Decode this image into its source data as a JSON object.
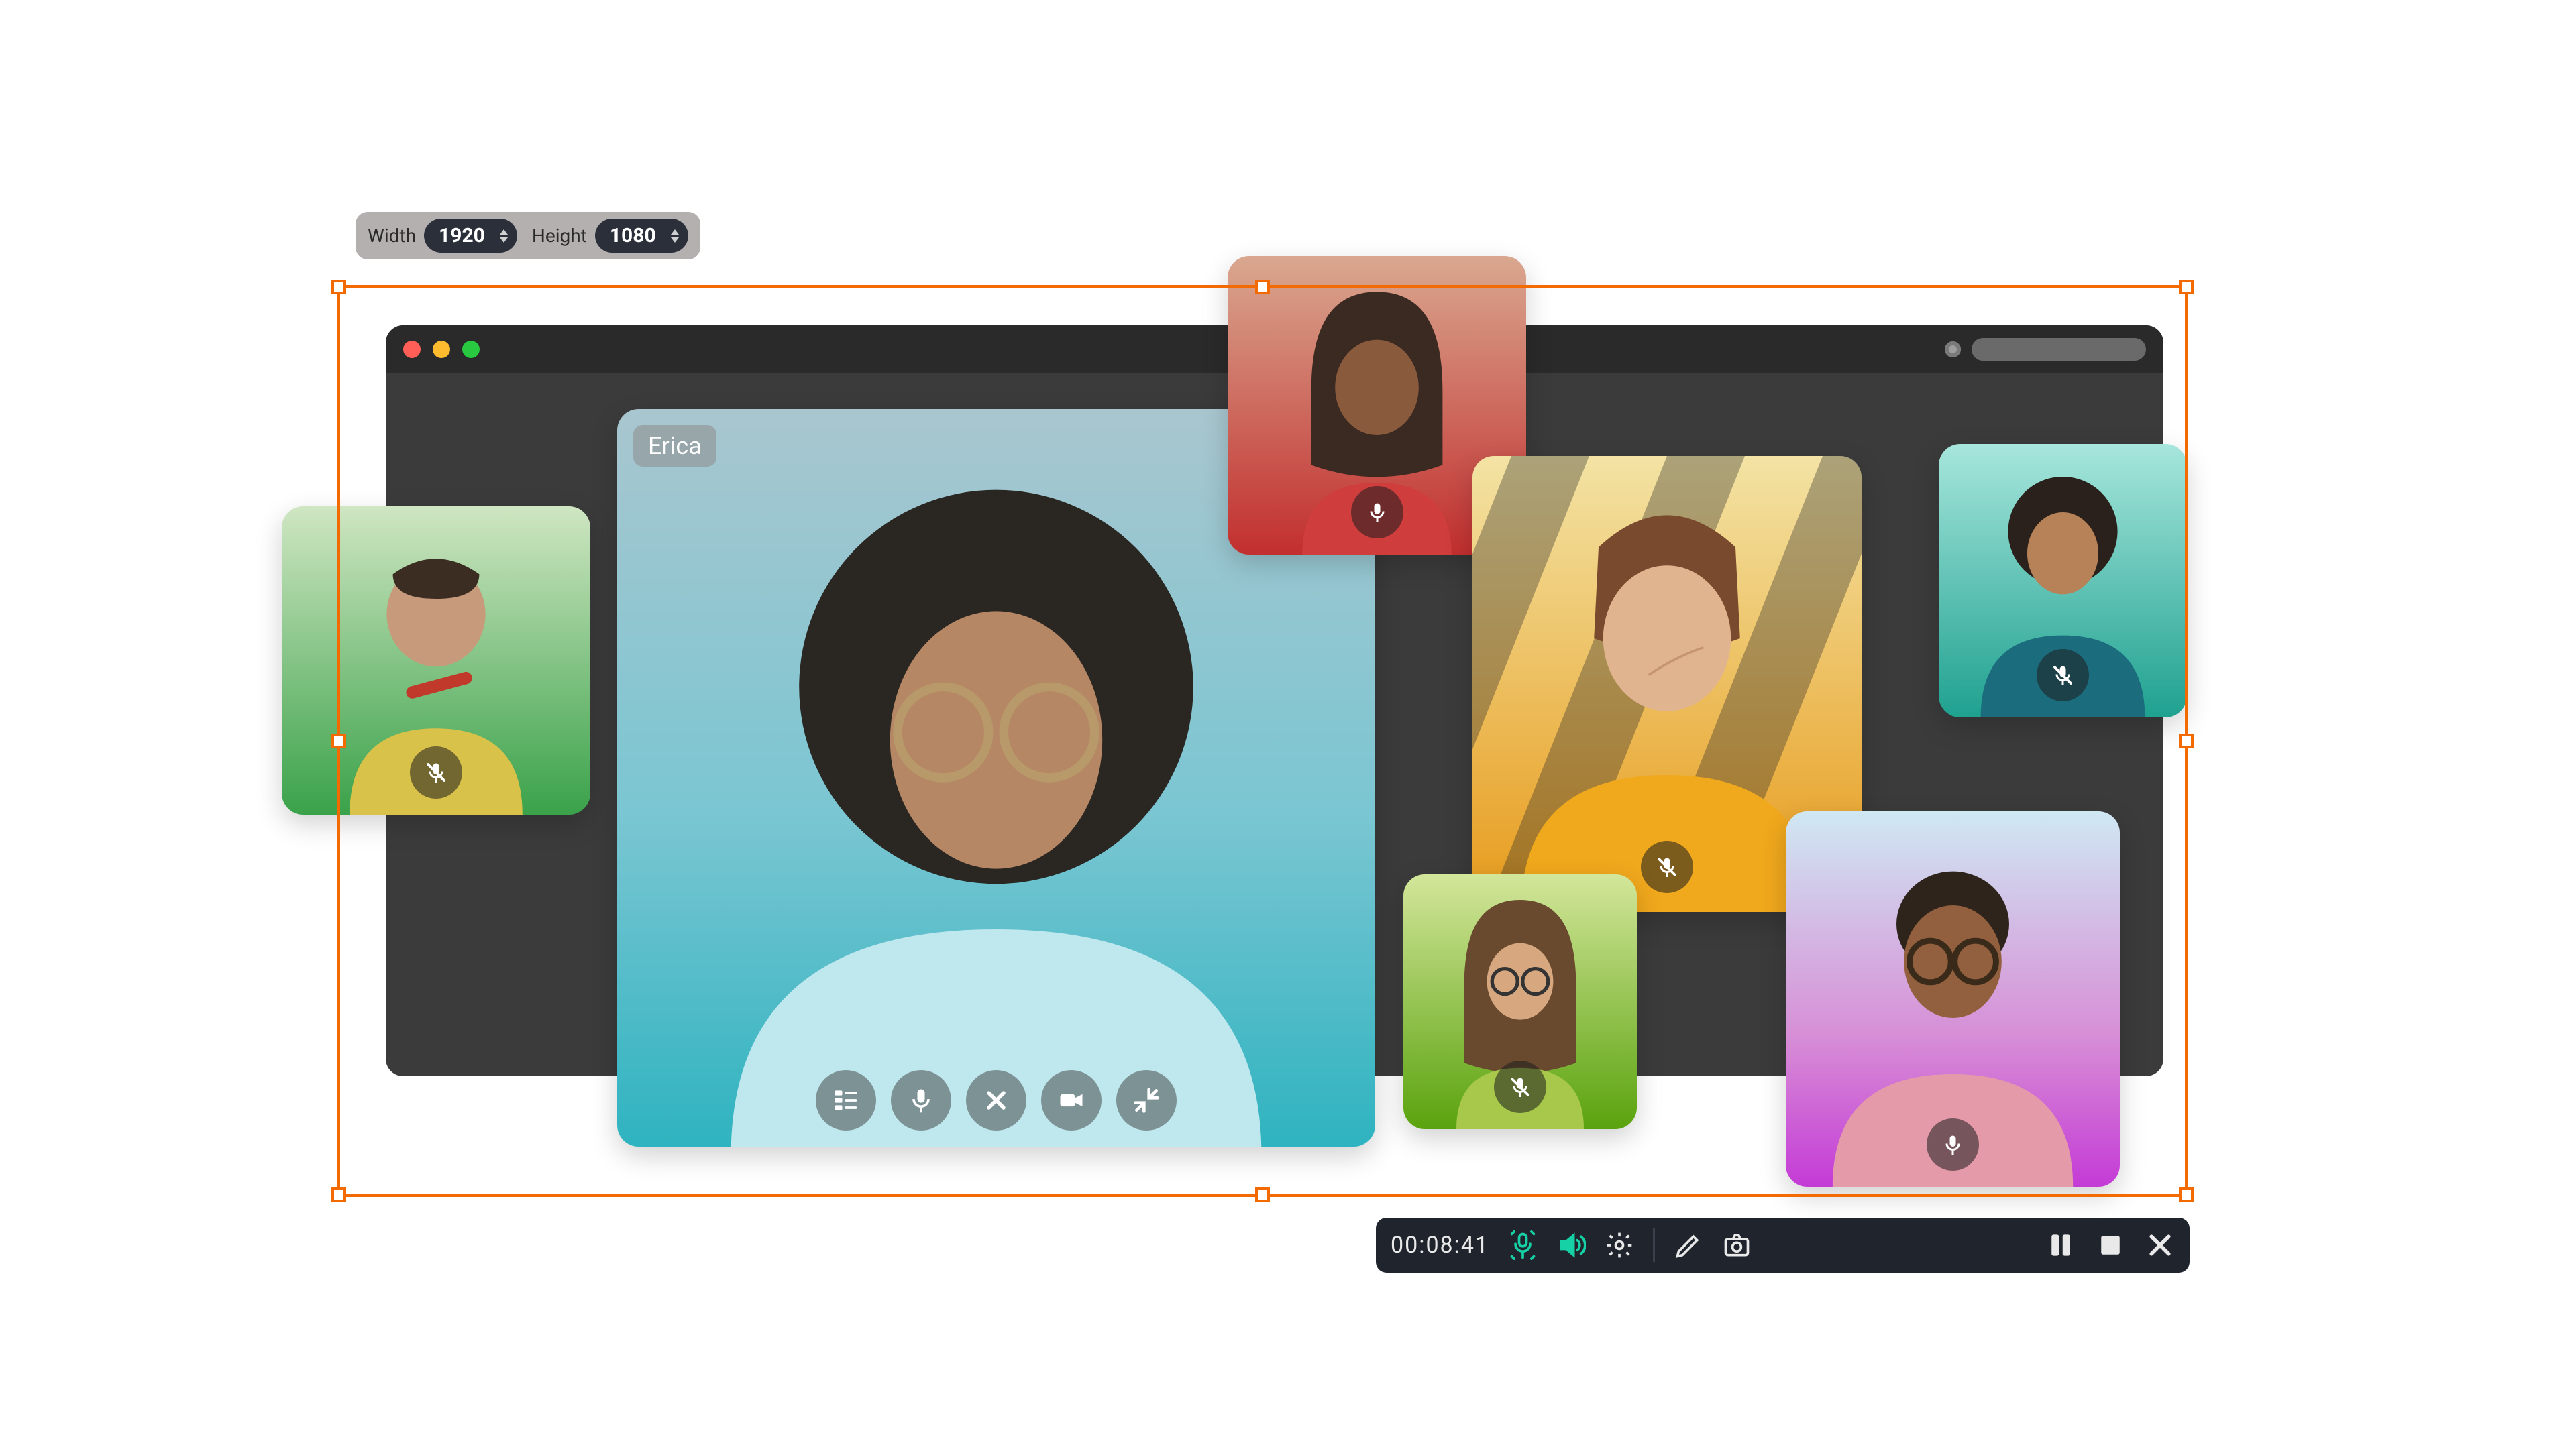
{
  "dimensions": {
    "width_label": "Width",
    "width_value": "1920",
    "height_label": "Height",
    "height_value": "1080"
  },
  "capture_frame": {
    "color": "#f36a00"
  },
  "browser": {
    "traffic_colors": {
      "close": "#ff5f57",
      "minimize": "#febc2e",
      "maximize": "#28c840"
    }
  },
  "tiles": {
    "main": {
      "name": "Erica",
      "controls": [
        "chapters",
        "mic",
        "close",
        "video",
        "collapse"
      ]
    },
    "small": [
      {
        "id": "top-center",
        "mic_state": "on",
        "tint_top": "#d67b6b",
        "tint_bottom": "#c12f2f"
      },
      {
        "id": "left",
        "mic_state": "muted",
        "tint_top": "#9fd88a",
        "tint_bottom": "#3aa24a"
      },
      {
        "id": "right-top",
        "mic_state": "muted",
        "tint_top": "#4fd0c0",
        "tint_bottom": "#1fa190"
      },
      {
        "id": "center-right",
        "mic_state": "muted",
        "tint_top": "#f6cf5a",
        "tint_bottom": "#e79a1a"
      },
      {
        "id": "bottom-left",
        "mic_state": "muted",
        "tint_top": "#b7d84a",
        "tint_bottom": "#5aa30e"
      },
      {
        "id": "bottom-right",
        "mic_state": "on",
        "tint_top": "#8fd2ef",
        "tint_bottom": "#c43bd6"
      }
    ]
  },
  "recorder": {
    "timer": "00:08:41",
    "buttons": [
      "mic",
      "speaker",
      "settings",
      "pencil",
      "camera",
      "pause",
      "stop",
      "close"
    ],
    "accent": "#17d1a6"
  }
}
